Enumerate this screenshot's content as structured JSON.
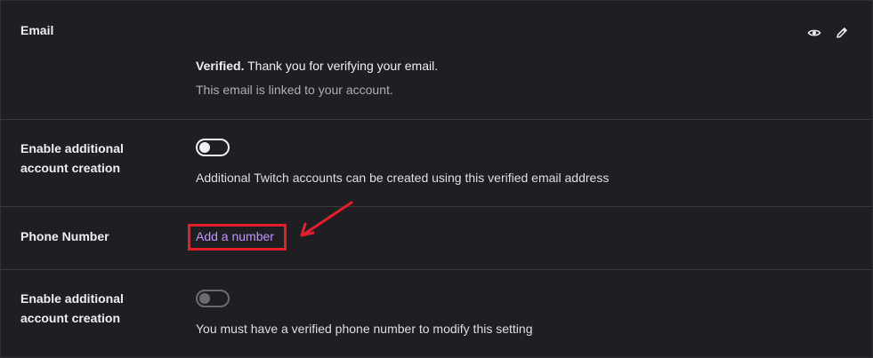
{
  "email": {
    "label": "Email",
    "verified_bold": "Verified.",
    "verified_rest": " Thank you for verifying your email.",
    "linked_note": "This email is linked to your account."
  },
  "email_additional": {
    "label_line1": "Enable additional",
    "label_line2": "account creation",
    "toggle_on": false,
    "description": "Additional Twitch accounts can be created using this verified email address"
  },
  "phone": {
    "label": "Phone Number",
    "add_link": "Add a number"
  },
  "phone_additional": {
    "label_line1": "Enable additional",
    "label_line2": "account creation",
    "toggle_on": false,
    "toggle_disabled": true,
    "description": "You must have a verified phone number to modify this setting"
  },
  "colors": {
    "background": "#1f1f23",
    "link": "#bf94ff",
    "annotation": "#e41e2b"
  },
  "icons": {
    "show": "eye-icon",
    "edit": "pencil-icon",
    "annotation_arrow": "arrow-icon"
  }
}
